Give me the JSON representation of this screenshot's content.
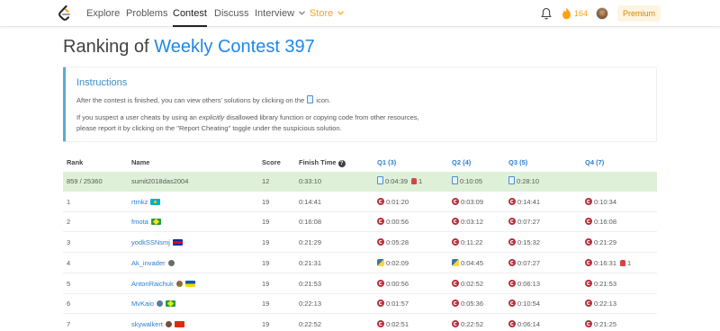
{
  "nav": {
    "items": [
      {
        "label": "Explore",
        "state": "normal"
      },
      {
        "label": "Problems",
        "state": "normal"
      },
      {
        "label": "Contest",
        "state": "active"
      },
      {
        "label": "Discuss",
        "state": "normal"
      },
      {
        "label": "Interview",
        "state": "dropdown"
      },
      {
        "label": "Store",
        "state": "store"
      }
    ],
    "streak": "164",
    "premium": "Premium"
  },
  "page": {
    "title_prefix": "Ranking of",
    "contest_name": "Weekly Contest 397"
  },
  "instructions": {
    "title": "Instructions",
    "line1_before": "After the contest is finished, you can view others' solutions by clicking on the",
    "line1_after": "icon.",
    "line2_before": "If you suspect a user cheats by using an",
    "line2_em": "explicitly",
    "line2_after": "disallowed library function or copying code from other resources,",
    "line3": "please report it by clicking on the \"Report Cheating\" toggle under the suspicious solution."
  },
  "table": {
    "headers": {
      "rank": "Rank",
      "name": "Name",
      "score": "Score",
      "finish": "Finish Time",
      "help": "?",
      "q1": "Q1 (3)",
      "q2": "Q2 (4)",
      "q3": "Q3 (5)",
      "q4": "Q4 (7)"
    },
    "rows": [
      {
        "rank": "859 / 25360",
        "name": "sumit2018das2004",
        "score": "12",
        "finish": "0:33:10",
        "q1": {
          "time": "0:04:39",
          "icon": "doc-icon",
          "bug": "1"
        },
        "q2": {
          "time": "0:10:05",
          "icon": "doc-icon"
        },
        "q3": {
          "time": "0:28:10",
          "icon": "doc-icon"
        },
        "q4": {
          "time": "",
          "icon": ""
        }
      },
      {
        "rank": "1",
        "name": "rtmkz",
        "flag": "kazakhstan",
        "score": "19",
        "finish": "0:14:41",
        "q1": {
          "time": "0:01:20",
          "icon": "cpp-icon"
        },
        "q2": {
          "time": "0:03:09",
          "icon": "cpp-icon"
        },
        "q3": {
          "time": "0:14:41",
          "icon": "cpp-icon"
        },
        "q4": {
          "time": "0:10:34",
          "icon": "cpp-icon"
        }
      },
      {
        "rank": "2",
        "name": "fmota",
        "flag": "brazil",
        "score": "19",
        "finish": "0:16:08",
        "q1": {
          "time": "0:00:56",
          "icon": "cpp-icon"
        },
        "q2": {
          "time": "0:03:12",
          "icon": "cpp-icon"
        },
        "q3": {
          "time": "0:07:27",
          "icon": "cpp-icon"
        },
        "q4": {
          "time": "0:16:08",
          "icon": "cpp-icon"
        }
      },
      {
        "rank": "3",
        "name": "yodkSSNsmj",
        "flag": "cambodia",
        "score": "19",
        "finish": "0:21:29",
        "q1": {
          "time": "0:05:28",
          "icon": "cpp-icon"
        },
        "q2": {
          "time": "0:11:22",
          "icon": "cpp-icon"
        },
        "q3": {
          "time": "0:15:32",
          "icon": "cpp-icon"
        },
        "q4": {
          "time": "0:21:29",
          "icon": "cpp-icon"
        }
      },
      {
        "rank": "4",
        "name": "Ak_invader",
        "badge": "badge-icon",
        "score": "19",
        "finish": "0:21:31",
        "q1": {
          "time": "0:02:09",
          "icon": "python-icon"
        },
        "q2": {
          "time": "0:04:45",
          "icon": "python-icon"
        },
        "q3": {
          "time": "0:07:27",
          "icon": "cpp-icon"
        },
        "q4": {
          "time": "0:16:31",
          "icon": "cpp-icon",
          "bug": "1"
        }
      },
      {
        "rank": "5",
        "name": "AntonRaichuk",
        "badge": "badge-icon",
        "flag": "ukraine",
        "score": "19",
        "finish": "0:21:53",
        "q1": {
          "time": "0:00:56",
          "icon": "cpp-icon"
        },
        "q2": {
          "time": "0:02:52",
          "icon": "cpp-icon"
        },
        "q3": {
          "time": "0:06:13",
          "icon": "cpp-icon"
        },
        "q4": {
          "time": "0:21:53",
          "icon": "cpp-icon"
        }
      },
      {
        "rank": "6",
        "name": "MvKaio",
        "badge": "badge-icon",
        "flag": "brazil",
        "score": "19",
        "finish": "0:22:13",
        "q1": {
          "time": "0:01:57",
          "icon": "cpp-icon"
        },
        "q2": {
          "time": "0:05:36",
          "icon": "cpp-icon"
        },
        "q3": {
          "time": "0:10:54",
          "icon": "cpp-icon"
        },
        "q4": {
          "time": "0:22:13",
          "icon": "cpp-icon"
        }
      },
      {
        "rank": "7",
        "name": "skywalkert",
        "badge": "badge-icon",
        "flag": "china",
        "score": "19",
        "finish": "0:22:52",
        "q1": {
          "time": "0:02:51",
          "icon": "cpp-icon"
        },
        "q2": {
          "time": "0:22:52",
          "icon": "cpp-icon"
        },
        "q3": {
          "time": "0:06:14",
          "icon": "cpp-icon"
        },
        "q4": {
          "time": "0:21:25",
          "icon": "cpp-icon"
        }
      }
    ]
  },
  "colors": {
    "accent": "#1e88e5",
    "link": "#2e7fd0",
    "store": "#ffa116",
    "highlight_row": "#dff0d8",
    "cpp_icon": "#b5303b"
  }
}
